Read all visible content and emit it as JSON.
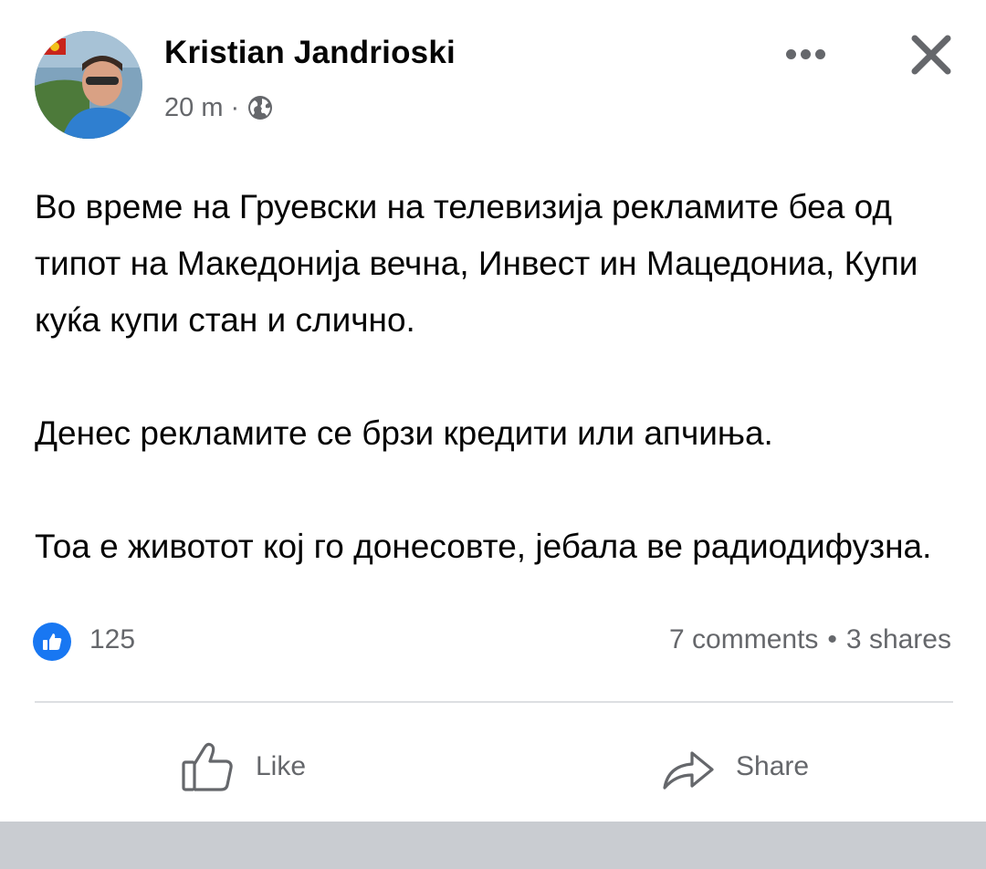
{
  "post": {
    "author": "Kristian Jandrioski",
    "time": "20 m",
    "separator": "·",
    "privacy_icon": "globe-icon",
    "body": [
      "Во време на Груевски на телевизија рекламите беа од типот на Македонија вечна, Инвест ин Мацедониа, Купи куќа купи стан и слично.",
      "Денес рекламите се брзи кредити или апчиња.",
      "Тоа е животот кој го донесовте, јебала ве радиодифузна."
    ]
  },
  "reactions": {
    "icon": "like-icon",
    "count": "125"
  },
  "engagement": {
    "comments": "7 comments",
    "dot": "•",
    "shares": "3 shares"
  },
  "actions": {
    "like_label": "Like",
    "share_label": "Share"
  },
  "colors": {
    "accent": "#1877f2",
    "secondary_text": "#65676b",
    "divider": "#dddfe2"
  }
}
